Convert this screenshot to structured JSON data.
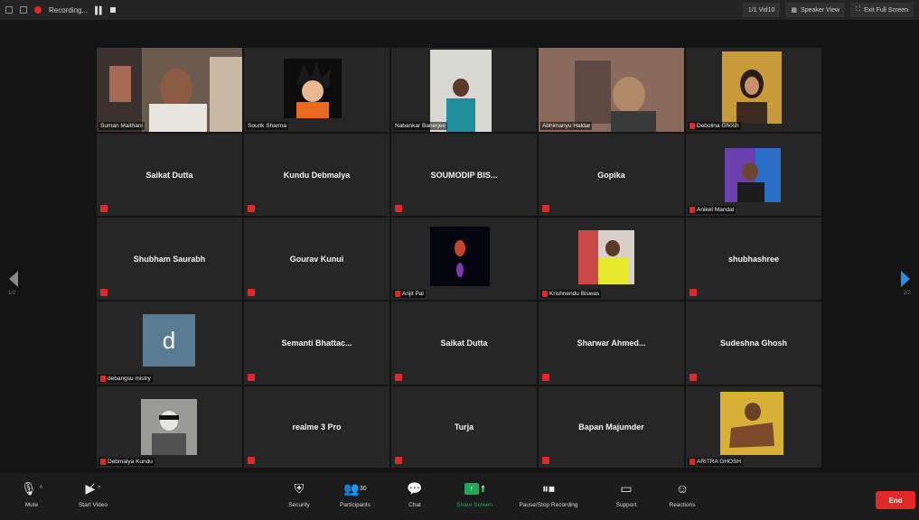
{
  "topbar": {
    "recording_label": "Recording...",
    "speaker_view_label": "Speaker View",
    "exit_fullscreen_label": "Exit Full Screen",
    "view_label": "1/1 Vid10"
  },
  "tiles": [
    {
      "name": "Suman Maithani",
      "type": "video",
      "active": true
    },
    {
      "name": "Sourik Sharma",
      "type": "image"
    },
    {
      "name": "Nabankar Banerjee",
      "type": "image"
    },
    {
      "name": "Abhimanyu Haldar",
      "type": "video"
    },
    {
      "name": "Debolina Ghosh",
      "type": "image",
      "muted": true
    },
    {
      "name": "Saikat Dutta",
      "type": "name",
      "muted": true
    },
    {
      "name": "Kundu Debmalya",
      "type": "name",
      "muted": true
    },
    {
      "name": "SOUMODIP BIS...",
      "type": "name",
      "muted": true
    },
    {
      "name": "Gopika",
      "type": "name",
      "muted": true
    },
    {
      "name": "Aniket Mandal",
      "type": "image",
      "muted": true
    },
    {
      "name": "Shubham Saurabh",
      "type": "name",
      "muted": true
    },
    {
      "name": "Gourav Kunui",
      "type": "name",
      "muted": true
    },
    {
      "name": "Arijit Pal",
      "type": "image",
      "muted": true
    },
    {
      "name": "Krishnendu Biswas",
      "type": "image",
      "muted": true
    },
    {
      "name": "shubhashree",
      "type": "name",
      "muted": true
    },
    {
      "name": "debangsu mistry",
      "type": "letter",
      "letter": "d",
      "muted": true
    },
    {
      "name": "Semanti Bhattac...",
      "type": "name",
      "muted": true
    },
    {
      "name": "Saikat Dutta",
      "type": "name",
      "muted": true
    },
    {
      "name": "Sharwar Ahmed...",
      "type": "name",
      "muted": true
    },
    {
      "name": "Sudeshna Ghosh",
      "type": "name",
      "muted": true
    },
    {
      "name": "Debmalya Kundu",
      "type": "image",
      "muted": true
    },
    {
      "name": "realme 3 Pro",
      "type": "name",
      "muted": true
    },
    {
      "name": "Turja",
      "type": "name",
      "muted": true
    },
    {
      "name": "Bapan Majumder",
      "type": "name",
      "muted": true
    },
    {
      "name": "ARITRA GHOSH",
      "type": "image",
      "muted": true
    }
  ],
  "page": {
    "left": "1/2",
    "right": "2/2"
  },
  "toolbar": {
    "mute": "Mute",
    "start_video": "Start Video",
    "security": "Security",
    "participants": "Participants",
    "participants_count": "30",
    "chat": "Chat",
    "share_screen": "Share Screen",
    "pause_stop_recording": "Pause/Stop Recording",
    "support": "Support",
    "reactions": "Reactions",
    "end": "End"
  },
  "colors": {
    "active_outline": "#c8e23a",
    "share_green": "#1fa85a",
    "end_red": "#e02828",
    "next_arrow": "#2e8ce6"
  }
}
